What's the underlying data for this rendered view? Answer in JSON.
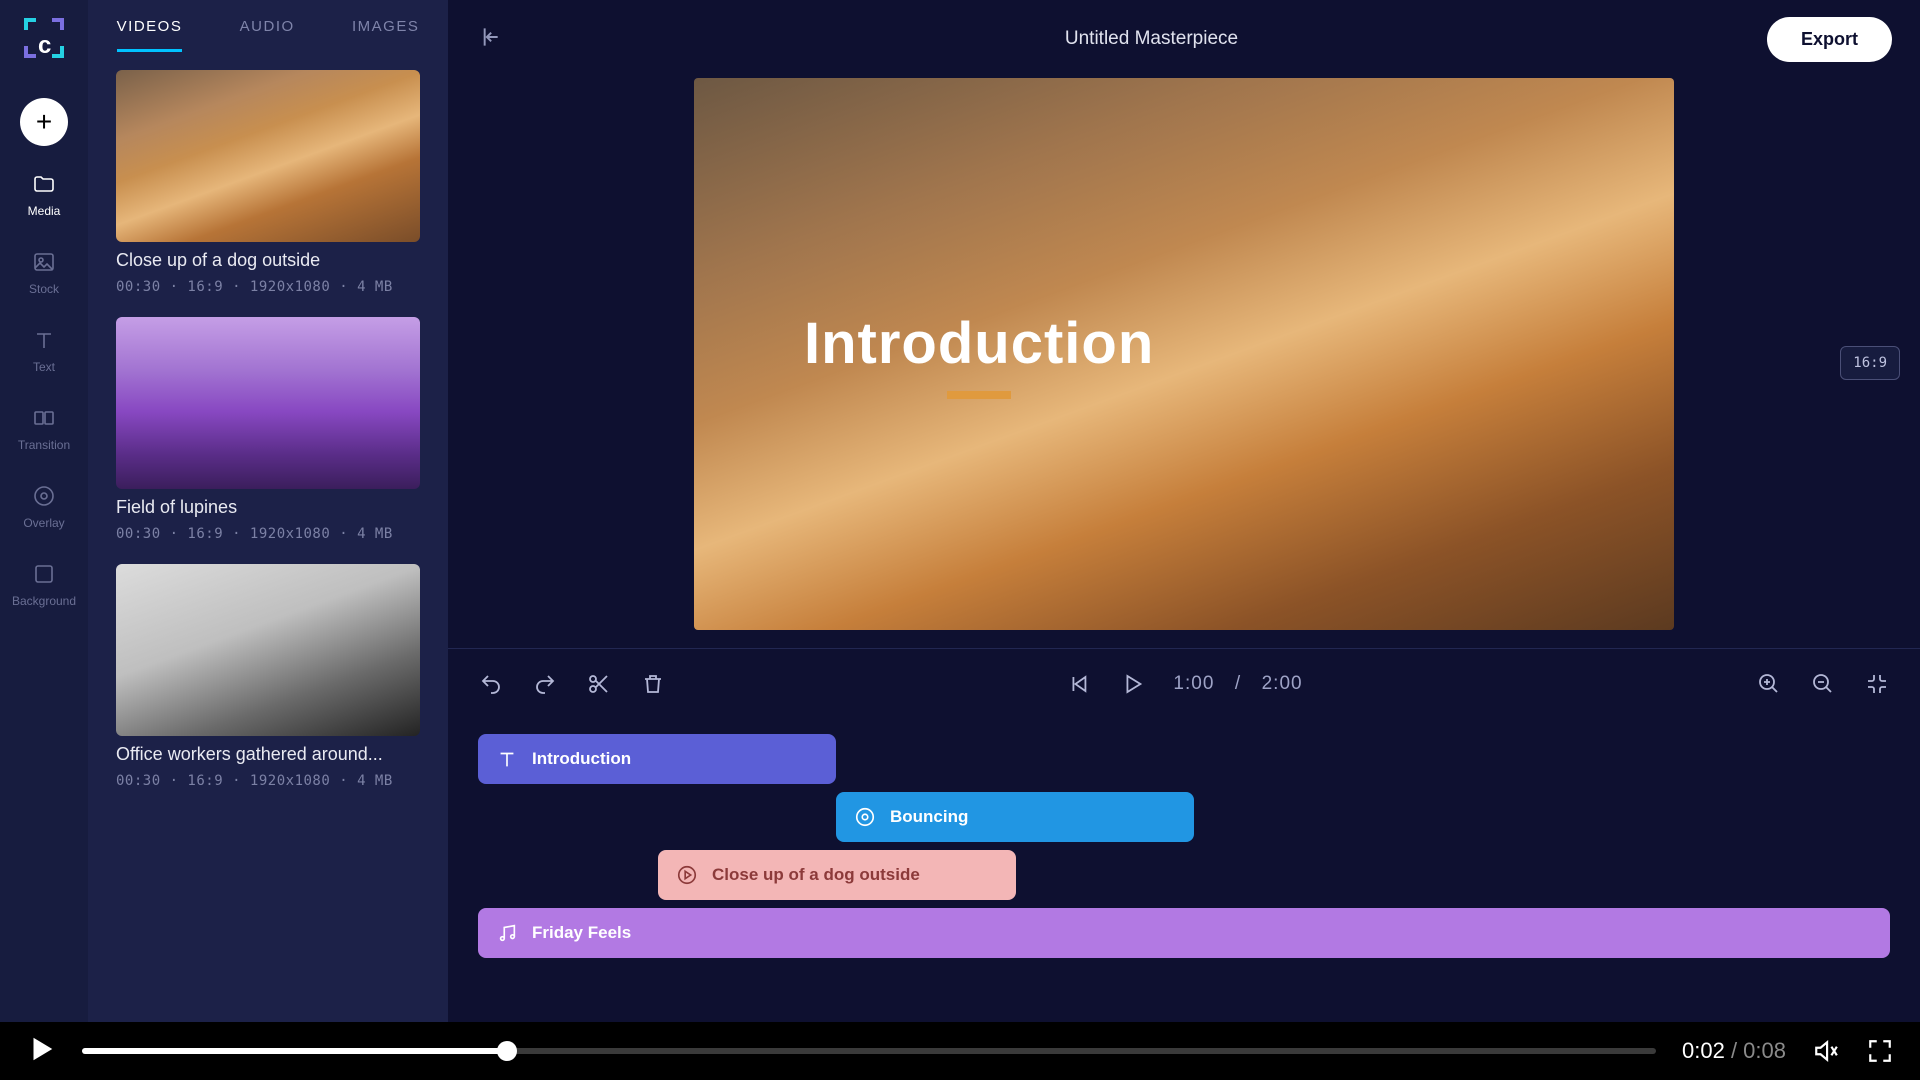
{
  "header": {
    "title": "Untitled Masterpiece",
    "export_label": "Export",
    "aspect_badge": "16:9"
  },
  "rail": {
    "items": [
      {
        "label": "Media"
      },
      {
        "label": "Stock"
      },
      {
        "label": "Text"
      },
      {
        "label": "Transition"
      },
      {
        "label": "Overlay"
      },
      {
        "label": "Background"
      }
    ]
  },
  "tabs": {
    "videos": "VIDEOS",
    "audio": "AUDIO",
    "images": "IMAGES"
  },
  "media": [
    {
      "title": "Close up of a dog outside",
      "meta": "00:30 · 16:9 · 1920x1080 · 4 MB"
    },
    {
      "title": "Field of lupines",
      "meta": "00:30 · 16:9 · 1920x1080 · 4 MB"
    },
    {
      "title": "Office workers gathered around...",
      "meta": "00:30 · 16:9 · 1920x1080 · 4 MB"
    }
  ],
  "preview": {
    "overlay_text": "Introduction"
  },
  "timeline_controls": {
    "time_current": "1:00",
    "time_sep": "/",
    "time_total": "2:00"
  },
  "tracks": {
    "text": "Introduction",
    "overlay": "Bouncing",
    "clip": "Close up of a dog outside",
    "audio": "Friday Feels"
  },
  "playback": {
    "current": "0:02",
    "sep": " / ",
    "duration": "0:08",
    "progress_percent": 27
  }
}
